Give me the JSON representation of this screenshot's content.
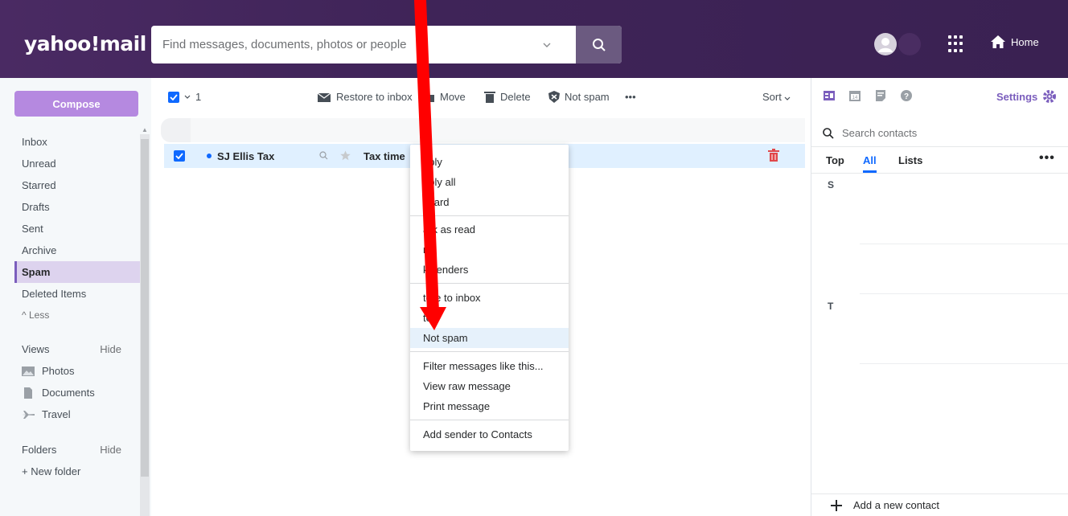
{
  "brand": {
    "logo_text": "yahoo!mail"
  },
  "header": {
    "search_placeholder": "Find messages, documents, photos or people",
    "search_icon": "search-icon",
    "apps_icon": "grid-icon",
    "home_label": "Home"
  },
  "leftnav": {
    "compose_label": "Compose",
    "folders": [
      {
        "label": "Inbox"
      },
      {
        "label": "Unread"
      },
      {
        "label": "Starred"
      },
      {
        "label": "Drafts"
      },
      {
        "label": "Sent"
      },
      {
        "label": "Archive"
      },
      {
        "label": "Spam",
        "active": true
      },
      {
        "label": "Deleted Items"
      }
    ],
    "less_label": "^ Less",
    "views_label": "Views",
    "views_hide": "Hide",
    "views": [
      {
        "label": "Photos",
        "icon": "photo-icon"
      },
      {
        "label": "Documents",
        "icon": "document-icon"
      },
      {
        "label": "Travel",
        "icon": "plane-icon"
      }
    ],
    "folders_label": "Folders",
    "folders_hide": "Hide",
    "new_folder": "+ New folder"
  },
  "toolbar": {
    "selected_count": "1",
    "restore": "Restore to inbox",
    "move": "Move",
    "delete": "Delete",
    "not_spam": "Not spam",
    "more": "•••",
    "sort": "Sort"
  },
  "message": {
    "sender": "SJ Ellis Tax",
    "subject": "Tax time"
  },
  "context_menu": {
    "groups": [
      [
        "eply",
        "eply all",
        "rward"
      ],
      [
        "ark as read",
        "r",
        "k senders"
      ],
      [
        "tore to inbox",
        "te",
        "Not spam"
      ],
      [
        "Filter messages like this...",
        "View raw message",
        "Print message"
      ],
      [
        "Add sender to Contacts"
      ]
    ]
  },
  "rightpanel": {
    "settings_label": "Settings",
    "search_placeholder": "Search contacts",
    "tabs": [
      "Top",
      "All",
      "Lists"
    ],
    "active_tab": "All",
    "more": "•••",
    "letters": [
      "S",
      "T"
    ],
    "add_contact": "Add a new contact"
  },
  "colors": {
    "header_bg": "#3f2458",
    "compose_bg": "#b589e0",
    "accent_blue": "#0f69ff",
    "active_nav": "#ddd3ee",
    "arrow_red": "#ff0000"
  }
}
